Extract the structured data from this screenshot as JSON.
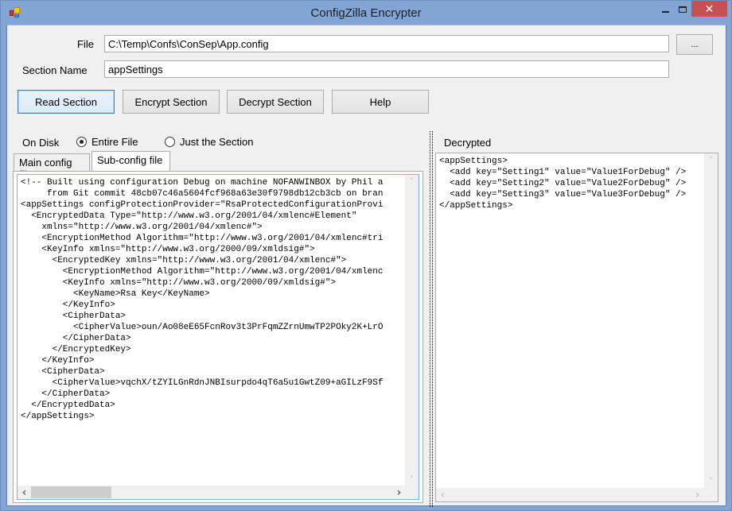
{
  "window": {
    "title": "ConfigZilla Encrypter",
    "icon": "app-icon",
    "controls": {
      "minimize_icon": "minimize-icon",
      "maximize_icon": "maximize-icon",
      "close_label": "✕"
    }
  },
  "form": {
    "file_label": "File",
    "file_value": "C:\\Temp\\Confs\\ConSep\\App.config",
    "browse_label": "...",
    "section_label": "Section Name",
    "section_value": "appSettings"
  },
  "toolbar": {
    "read_label": "Read Section",
    "encrypt_label": "Encrypt Section",
    "decrypt_label": "Decrypt Section",
    "help_label": "Help"
  },
  "on_disk": {
    "label": "On Disk",
    "options": [
      {
        "label": "Entire File",
        "checked": true
      },
      {
        "label": "Just the Section",
        "checked": false
      }
    ]
  },
  "tabs": [
    {
      "label": "Main config file",
      "active": false
    },
    {
      "label": "Sub-config file",
      "active": true
    }
  ],
  "left_code": {
    "lines": [
      "<!-- Built using configuration Debug on machine NOFANWINBOX by Phil a",
      "     from Git commit 48cb07c46a5604fcf968a63e30f9798db12cb3cb on bran",
      "<appSettings configProtectionProvider=\"RsaProtectedConfigurationProvi",
      "  <EncryptedData Type=\"http://www.w3.org/2001/04/xmlenc#Element\"",
      "    xmlns=\"http://www.w3.org/2001/04/xmlenc#\">",
      "    <EncryptionMethod Algorithm=\"http://www.w3.org/2001/04/xmlenc#tri",
      "    <KeyInfo xmlns=\"http://www.w3.org/2000/09/xmldsig#\">",
      "      <EncryptedKey xmlns=\"http://www.w3.org/2001/04/xmlenc#\">",
      "        <EncryptionMethod Algorithm=\"http://www.w3.org/2001/04/xmlenc",
      "        <KeyInfo xmlns=\"http://www.w3.org/2000/09/xmldsig#\">",
      "          <KeyName>Rsa Key</KeyName>",
      "        </KeyInfo>",
      "        <CipherData>",
      "          <CipherValue>oun/Ao08eE65FcnRov3t3PrFqmZZrnUmwTP2POky2K+LrO",
      "        </CipherData>",
      "      </EncryptedKey>",
      "    </KeyInfo>",
      "    <CipherData>",
      "      <CipherValue>vqchX/tZYILGnRdnJNBIsurpdo4qT6a5u1GwtZ09+aGILzF9Sf",
      "    </CipherData>",
      "  </EncryptedData>",
      "</appSettings>"
    ]
  },
  "decrypted": {
    "label": "Decrypted",
    "lines": [
      "<appSettings>",
      "  <add key=\"Setting1\" value=\"Value1ForDebug\" />",
      "  <add key=\"Setting2\" value=\"Value2ForDebug\" />",
      "  <add key=\"Setting3\" value=\"Value3ForDebug\" />",
      "</appSettings>"
    ]
  },
  "scroll": {
    "up": "˄",
    "down": "˅",
    "left": "‹",
    "right": "›"
  }
}
